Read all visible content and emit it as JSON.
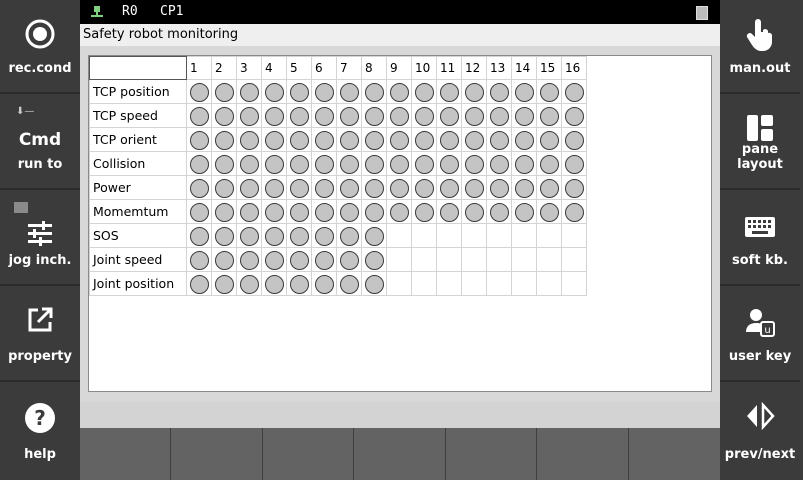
{
  "left_panel": {
    "buttons": [
      {
        "label": "rec.cond",
        "icon": "record-circle-icon"
      },
      {
        "label": "run to",
        "big": "Cmd",
        "icon": "cmd-icon"
      },
      {
        "label": "jog inch.",
        "icon": "sliders-icon"
      },
      {
        "label": "property",
        "icon": "external-link-icon"
      },
      {
        "label": "help",
        "icon": "question-icon"
      }
    ]
  },
  "right_panel": {
    "buttons": [
      {
        "label": "man.out",
        "icon": "hand-pointer-icon"
      },
      {
        "label": "pane layout",
        "icon": "pane-layout-icon"
      },
      {
        "label": "soft kb.",
        "icon": "keyboard-icon"
      },
      {
        "label": "user key",
        "icon": "user-key-icon"
      },
      {
        "label": "prev/next",
        "icon": "prev-next-icon"
      }
    ]
  },
  "status": {
    "robot": "R0",
    "program": "CP1"
  },
  "window": {
    "title": "Safety robot monitoring"
  },
  "monitor": {
    "columns": [
      "1",
      "2",
      "3",
      "4",
      "5",
      "6",
      "7",
      "8",
      "9",
      "10",
      "11",
      "12",
      "13",
      "14",
      "15",
      "16"
    ],
    "rows": [
      {
        "label": "TCP position",
        "count": 16
      },
      {
        "label": "TCP speed",
        "count": 16
      },
      {
        "label": "TCP orient",
        "count": 16
      },
      {
        "label": "Collision",
        "count": 16
      },
      {
        "label": "Power",
        "count": 16
      },
      {
        "label": "Momemtum",
        "count": 16
      },
      {
        "label": "SOS",
        "count": 8
      },
      {
        "label": "Joint speed",
        "count": 8
      },
      {
        "label": "Joint position",
        "count": 8
      }
    ],
    "indicator_color": "#c4c4c4"
  },
  "function_keys": [
    "",
    "",
    "",
    "",
    "",
    "",
    ""
  ]
}
